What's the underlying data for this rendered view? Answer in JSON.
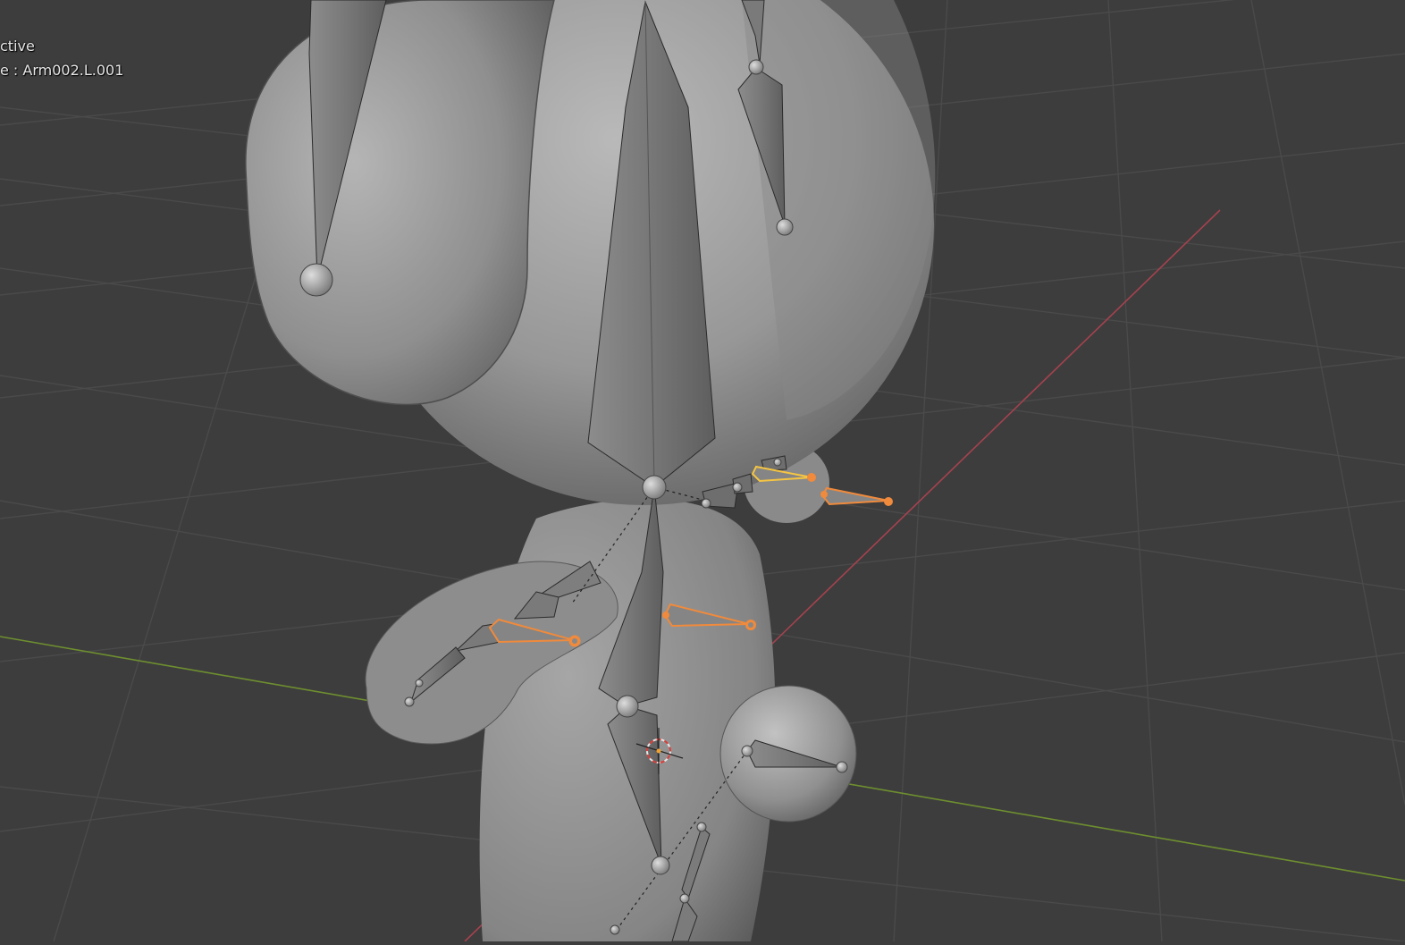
{
  "viewport": {
    "mode_text": "ctive",
    "bone_prefix": "e : ",
    "active_bone": "Arm002.L.001"
  },
  "colors": {
    "background": "#3d3d3d",
    "grid": "#4a4a4a",
    "axis_x": "#a5424f",
    "axis_y": "#6e8f2f",
    "mesh": "#9a9a9a",
    "bone": "#7b7b7b",
    "bone_selected": "#f08a3c",
    "bone_active": "#f5c542"
  }
}
